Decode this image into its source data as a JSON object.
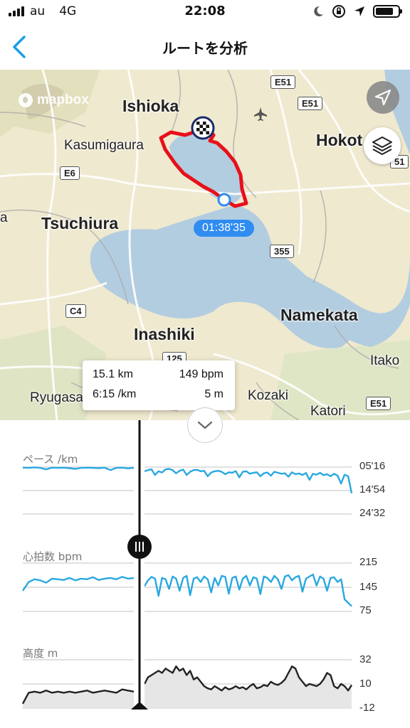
{
  "status": {
    "carrier": "au",
    "network": "4G",
    "time": "22:08",
    "battery_level": 0.8
  },
  "nav": {
    "title": "ルートを分析",
    "back_icon": "chevron-left-icon"
  },
  "map": {
    "attribution": "mapbox",
    "places": {
      "ishioka": "Ishioka",
      "kasumigaura": "Kasumigaura",
      "hokota": "Hokot",
      "tsuchiura": "Tsuchiura",
      "namekata": "Namekata",
      "inashiki": "Inashiki",
      "itako": "Itako",
      "ryugasaki": "Ryugasa",
      "kozaki": "Kozaki",
      "katori": "Katori",
      "edge_a": "a"
    },
    "shields": {
      "e51_top": "E51",
      "e51_mid": "E51",
      "e6": "E6",
      "r51": "51",
      "r355": "355",
      "c4": "C4",
      "r125": "125",
      "e51_bottom": "E51"
    },
    "time_badge": "01:38'35",
    "route_color": "#e8101a",
    "water_color": "#b3cde0",
    "land_color": "#efe9cf"
  },
  "tooltip": {
    "distance": "15.1 km",
    "heart_rate": "149 bpm",
    "pace": "6:15 /km",
    "altitude": "5  m"
  },
  "charts": {
    "pace": {
      "label": "ペース /km",
      "ticks": [
        "05'16",
        "14'54",
        "24'32"
      ],
      "color": "#29a8e0"
    },
    "heart_rate": {
      "label": "心拍数 bpm",
      "ticks": [
        "215",
        "145",
        "75"
      ],
      "color": "#29a8e0"
    },
    "altitude": {
      "label": "高度 m",
      "ticks": [
        "32",
        "10",
        "-12"
      ],
      "color": "#222222"
    }
  },
  "chart_data": [
    {
      "type": "line",
      "title": "ペース /km",
      "ylim": [
        "05'16",
        "24'32"
      ],
      "note_values": "pace in min/km, sampled across workout (x = fraction of workout)",
      "series": [
        {
          "values": [
            5.5,
            5.6,
            5.4,
            5.6,
            6.2,
            5.5,
            5.6,
            5.5,
            5.7,
            6.0,
            5.6,
            5.5,
            5.6,
            5.7,
            5.5,
            6.5,
            5.6,
            5.5,
            5.8,
            5.6,
            7.0,
            6.5,
            6.2,
            8.5,
            7.0,
            7.5,
            6.2,
            6.0,
            6.5,
            7.8,
            6.8,
            6.3,
            8.5,
            7.2,
            6.5,
            6.4,
            7.0,
            6.8,
            9.0,
            7.5,
            7.0,
            6.8,
            7.2,
            8.2,
            7.4,
            7.6,
            6.9,
            9.5,
            7.2,
            7.0,
            8.0,
            7.6,
            7.4,
            9.0,
            7.8,
            7.5,
            8.8,
            7.2,
            7.6,
            8.0,
            7.8,
            9.2,
            7.4,
            8.2,
            7.9,
            8.5,
            7.7,
            10.5,
            8.0,
            8.4,
            7.6,
            8.6,
            8.2,
            9.0,
            8.0,
            8.8,
            12.0,
            8.4,
            9.0,
            16.0
          ]
        }
      ]
    },
    {
      "type": "line",
      "title": "心拍数 bpm",
      "ylim": [
        75,
        215
      ],
      "series": [
        {
          "values": [
            135,
            160,
            168,
            165,
            158,
            170,
            168,
            166,
            172,
            165,
            170,
            168,
            174,
            166,
            170,
            172,
            168,
            175,
            170,
            172,
            148,
            165,
            175,
            170,
            120,
            172,
            168,
            140,
            176,
            170,
            135,
            172,
            178,
            122,
            170,
            174,
            160,
            176,
            168,
            130,
            172,
            150,
            178,
            175,
            126,
            172,
            176,
            138,
            170,
            178,
            150,
            174,
            170,
            125,
            176,
            172,
            160,
            178,
            168,
            140,
            176,
            180,
            165,
            174,
            178,
            132,
            170,
            176,
            182,
            150,
            176,
            170,
            135,
            172,
            174,
            160,
            168,
            110,
            100,
            90
          ]
        }
      ]
    },
    {
      "type": "area",
      "title": "高度 m",
      "ylim": [
        -12,
        32
      ],
      "series": [
        {
          "values": [
            -8,
            2,
            3,
            2,
            4,
            2,
            3,
            2,
            3,
            2,
            3,
            4,
            2,
            3,
            4,
            3,
            2,
            5,
            4,
            3,
            10,
            16,
            18,
            20,
            22,
            20,
            24,
            22,
            20,
            26,
            22,
            24,
            18,
            22,
            14,
            16,
            12,
            8,
            6,
            5,
            8,
            6,
            4,
            7,
            5,
            6,
            8,
            6,
            7,
            5,
            8,
            10,
            6,
            7,
            9,
            8,
            12,
            10,
            9,
            11,
            14,
            20,
            26,
            24,
            16,
            12,
            8,
            10,
            9,
            8,
            10,
            14,
            20,
            18,
            8,
            6,
            10,
            8,
            4,
            9
          ]
        }
      ]
    }
  ]
}
